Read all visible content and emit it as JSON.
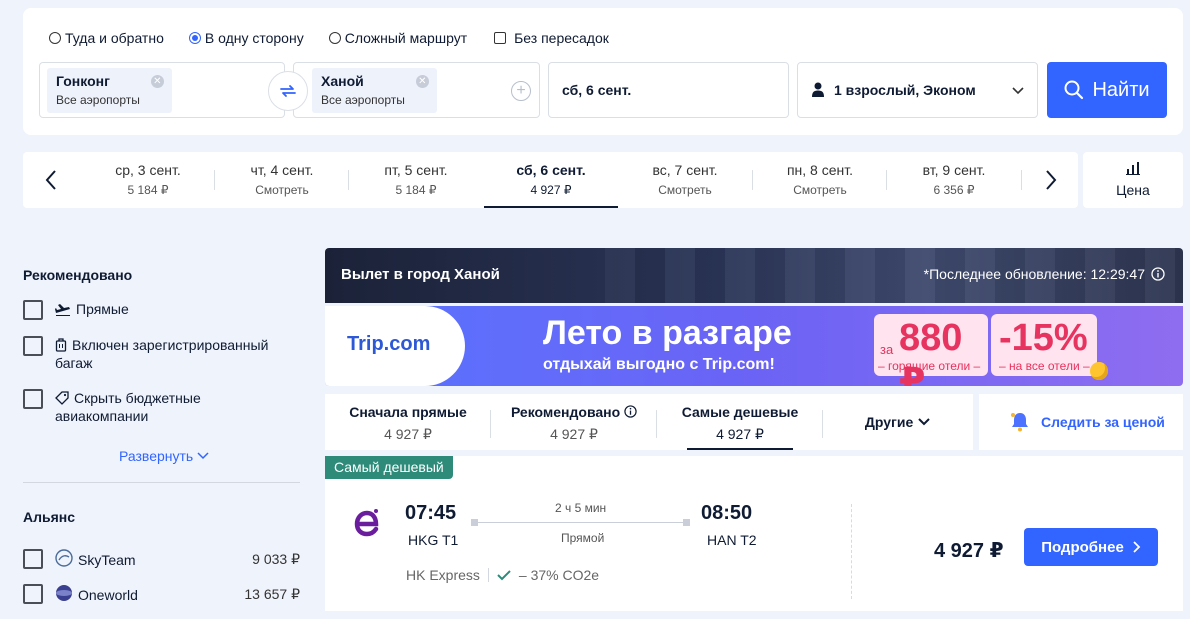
{
  "search": {
    "trip_options": [
      {
        "label": "Туда и обратно",
        "checked": false
      },
      {
        "label": "В одну сторону",
        "checked": true
      },
      {
        "label": "Сложный маршрут",
        "checked": false
      }
    ],
    "nonstop_label": "Без пересадок",
    "origin": {
      "city": "Гонконг",
      "sub": "Все аэропорты"
    },
    "destination": {
      "city": "Ханой",
      "sub": "Все аэропорты"
    },
    "date": "сб, 6 сент.",
    "passengers": "1 взрослый, Эконом",
    "search_button": "Найти"
  },
  "date_strip": {
    "days": [
      {
        "label": "ср, 3 сент.",
        "price": "5 184 ₽",
        "active": false
      },
      {
        "label": "чт, 4 сент.",
        "price": "Смотреть",
        "active": false
      },
      {
        "label": "пт, 5 сент.",
        "price": "5 184 ₽",
        "active": false
      },
      {
        "label": "сб, 6 сент.",
        "price": "4 927 ₽",
        "active": true
      },
      {
        "label": "вс, 7 сент.",
        "price": "Смотреть",
        "active": false
      },
      {
        "label": "пн, 8 сент.",
        "price": "Смотреть",
        "active": false
      },
      {
        "label": "вт, 9 сент.",
        "price": "6 356 ₽",
        "active": false
      }
    ],
    "price_tab": "Цена"
  },
  "sidebar": {
    "recommended_title": "Рекомендовано",
    "recommended": [
      {
        "label": "Прямые",
        "icon": "plane-icon"
      },
      {
        "label": "Включен зарегистрированный багаж",
        "icon": "luggage-icon"
      },
      {
        "label": "Скрыть бюджетные авиакомпании",
        "icon": "tag-icon"
      }
    ],
    "expand_label": "Развернуть",
    "alliance_title": "Альянс",
    "alliances": [
      {
        "name": "SkyTeam",
        "price": "9 033 ₽"
      },
      {
        "name": "Oneworld",
        "price": "13 657 ₽"
      }
    ]
  },
  "hero": {
    "title": "Вылет в город Ханой",
    "update": "*Последнее обновление: 12:29:47"
  },
  "banner": {
    "logo": "Trip.com",
    "headline": "Лето в разгаре",
    "subline": "отдыхай выгодно с Trip.com!",
    "promo1_prefix": "за",
    "promo1_value": "880 ₽",
    "promo1_foot": "– горящие отели –",
    "promo2_value": "-15%",
    "promo2_foot": "– на все отели –"
  },
  "sort": {
    "tabs": [
      {
        "label": "Сначала прямые",
        "price": "4 927 ₽",
        "active": false
      },
      {
        "label": "Рекомендовано",
        "price": "4 927 ₽",
        "active": false
      },
      {
        "label": "Самые дешевые",
        "price": "4 927 ₽",
        "active": true
      }
    ],
    "other_label": "Другие",
    "watch_label": "Следить за ценой"
  },
  "flight": {
    "badge": "Самый дешевый",
    "dep_time": "07:45",
    "dep_code": "HKG T1",
    "arr_time": "08:50",
    "arr_code": "HAN T2",
    "duration": "2 ч 5 мин",
    "stops": "Прямой",
    "airline": "HK Express",
    "co2": "– 37% CO2e",
    "price": "4 927 ₽",
    "detail_button": "Подробнее"
  },
  "colors": {
    "accent": "#3264ff",
    "badge": "#2e8b7a",
    "promo": "#e6335f"
  }
}
